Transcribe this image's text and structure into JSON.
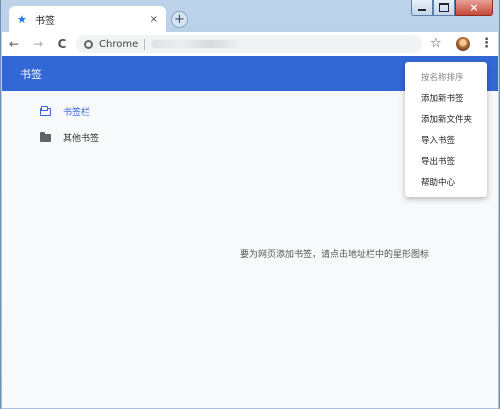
{
  "tab": {
    "title": "书签",
    "close": "×"
  },
  "new_tab": "+",
  "window_controls": {
    "close": "×"
  },
  "toolbar": {
    "back": "←",
    "forward": "→",
    "reload": "C",
    "omnibox_label": "Chrome",
    "star": "☆",
    "menu": "⋮"
  },
  "page": {
    "title": "书签",
    "folders": [
      {
        "label": "书签栏"
      },
      {
        "label": "其他书签"
      }
    ],
    "empty_message": "要为网页添加书签，请点击地址栏中的星形图标"
  },
  "menu": {
    "items": [
      {
        "label": "按名称排序",
        "disabled": true
      },
      {
        "label": "添加新书签"
      },
      {
        "label": "添加新文件夹"
      },
      {
        "label": "导入书签"
      },
      {
        "label": "导出书签"
      },
      {
        "label": "帮助中心"
      }
    ]
  },
  "colors": {
    "accent": "#3367d6",
    "page_bg": "#f8f9fa"
  }
}
